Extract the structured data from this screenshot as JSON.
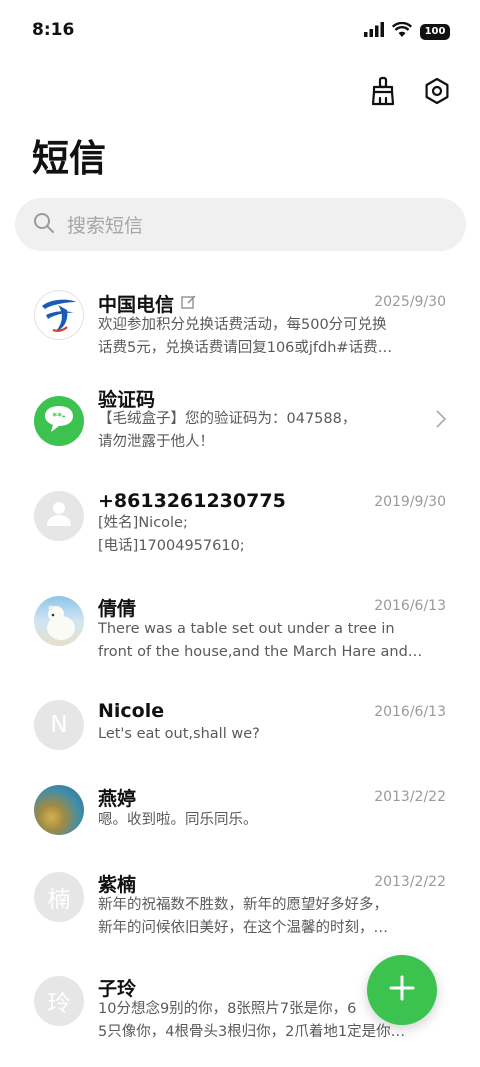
{
  "status_bar": {
    "time": "8:16",
    "battery": "100"
  },
  "header": {
    "title": "短信",
    "clean_icon": "broom-icon",
    "settings_icon": "gear-icon"
  },
  "search": {
    "placeholder": "搜索短信"
  },
  "threads": [
    {
      "contact": "中国电信",
      "date": "2025/9/30",
      "line1": "欢迎参加积分兑换话费活动，每500分可兑换",
      "line2": "话费5元，兑换话费请回复106或jfdh#话费…"
    },
    {
      "contact": "验证码",
      "date": "",
      "line1": "【毛绒盒子】您的验证码为：047588，",
      "line2": "请勿泄露于他人！"
    },
    {
      "contact": "+8613261230775",
      "date": "2019/9/30",
      "line1": "[姓名]Nicole;",
      "line2": "[电话]17004957610;"
    },
    {
      "contact": "倩倩",
      "date": "2016/6/13",
      "line1": "There was a table set out under a tree in",
      "line2": "front of the house,and the March Hare and…"
    },
    {
      "contact": "Nicole",
      "date": "2016/6/13",
      "line1": "Let's eat out,shall we?",
      "avatar_letter": "N"
    },
    {
      "contact": "燕婷",
      "date": "2013/2/22",
      "line1": "嗯。收到啦。同乐同乐。"
    },
    {
      "contact": "紫楠",
      "date": "2013/2/22",
      "line1": "新年的祝福数不胜数，新年的愿望好多好多，",
      "line2": "新年的问候依旧美好，在这个温馨的时刻，…",
      "avatar_letter": "楠"
    },
    {
      "contact": "子玲",
      "date": "",
      "line1": "10分想念9别的你，8张照片7张是你，6",
      "line2": "5只像你，4根骨头3根归你，2爪着地1定是你…",
      "avatar_letter": "玲"
    }
  ],
  "colors": {
    "accent": "#3cc24e",
    "telecom_blue": "#1c5bb5"
  }
}
